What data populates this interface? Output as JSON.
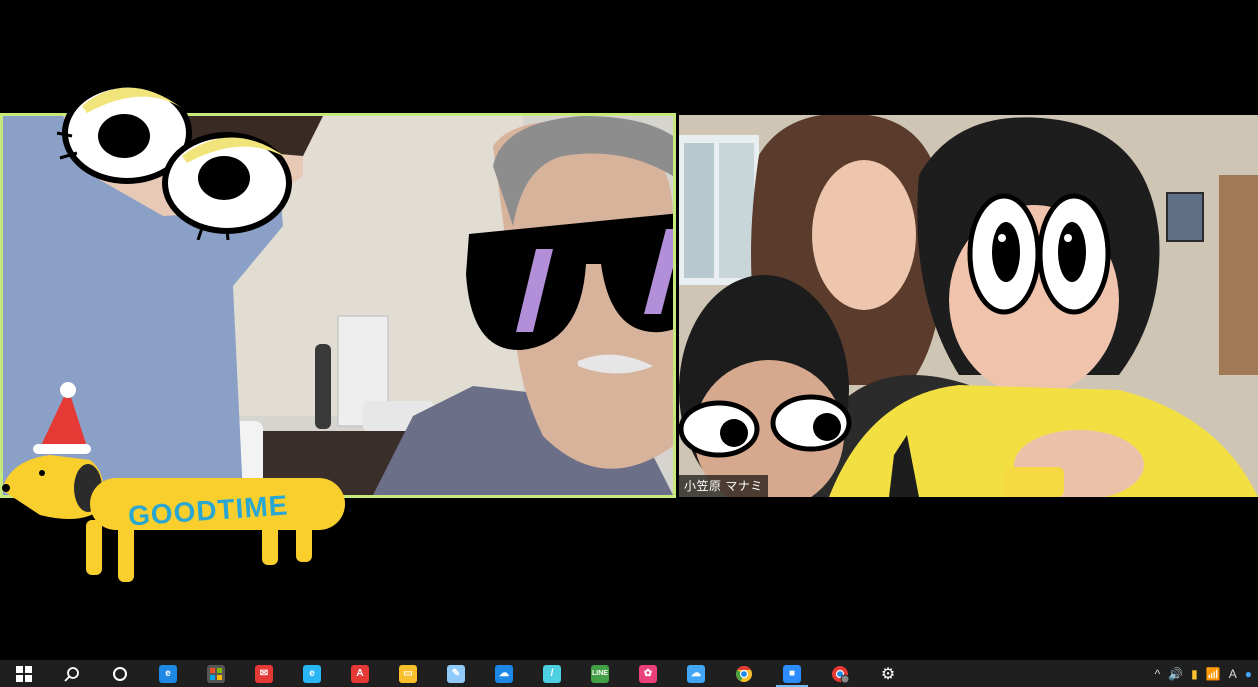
{
  "participants": [
    {
      "tile": "left",
      "name": ""
    },
    {
      "tile": "right",
      "name": "小笠原 マナミ"
    }
  ],
  "stickers": {
    "good_time_text": "GOODTIME"
  },
  "taskbar": {
    "apps": [
      {
        "name": "windows-start-icon",
        "color": "#ffffff"
      },
      {
        "name": "search-icon",
        "color": "#ffffff"
      },
      {
        "name": "cortana-icon",
        "color": "#ffffff"
      },
      {
        "name": "edge-icon",
        "color": "#1e88e5"
      },
      {
        "name": "store-icon",
        "color": "#ffffff"
      },
      {
        "name": "mail-red-icon",
        "color": "#e53935"
      },
      {
        "name": "ie-icon",
        "color": "#29b6f6"
      },
      {
        "name": "acrobat-icon",
        "color": "#e53935"
      },
      {
        "name": "file-explorer-icon",
        "color": "#fbc02d"
      },
      {
        "name": "paint-icon",
        "color": "#90caf9"
      },
      {
        "name": "cloud-upload-icon",
        "color": "#1e88e5"
      },
      {
        "name": "pen-icon",
        "color": "#4dd0e1"
      },
      {
        "name": "line-icon",
        "color": "#43a047"
      },
      {
        "name": "photos-icon",
        "color": "#ec407a"
      },
      {
        "name": "onedrive-icon",
        "color": "#42a5f5"
      },
      {
        "name": "chrome-icon",
        "color": "#fbc02d"
      },
      {
        "name": "zoom-icon",
        "color": "#2d8cff"
      },
      {
        "name": "chrome-profile-icon",
        "color": "#e53935"
      },
      {
        "name": "settings-gear-icon",
        "color": "#ffffff"
      }
    ],
    "active_index": 16,
    "tray": {
      "chevron": "^",
      "volume": "🔊",
      "ime": "A",
      "network": "📶"
    }
  }
}
